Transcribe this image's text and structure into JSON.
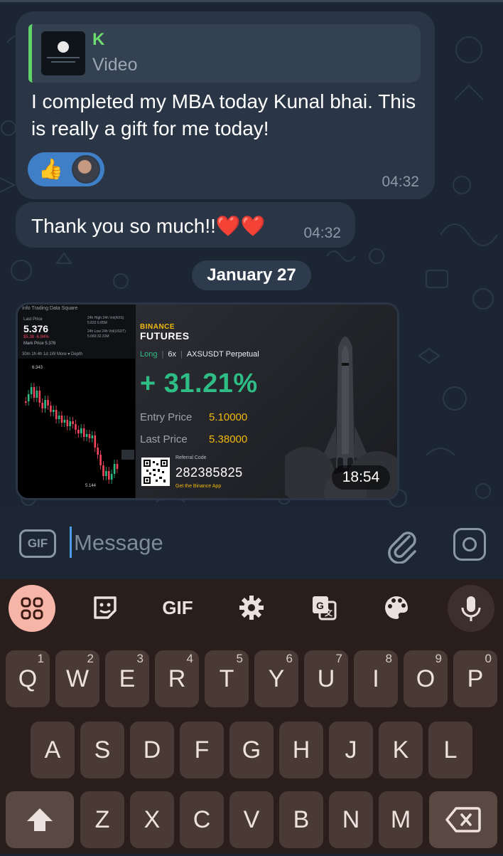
{
  "chat": {
    "message1": {
      "reply_name": "K",
      "reply_type": "Video",
      "text": "I completed my MBA today Kunal bhai. This is really a gift for me today!",
      "reaction_emoji": "👍",
      "time": "04:32"
    },
    "message2": {
      "text": "Thank you so much!!❤️❤️",
      "time": "04:32"
    },
    "date_separator": "January 27",
    "media": {
      "duration": "18:54",
      "app": {
        "tabs": "Info   Trading Data   Square",
        "last_price_label": "Last Price",
        "price": "5.376",
        "change": "$5.38  -6.94%",
        "mark_price": "Mark Price  5.376",
        "high_label": "24h High   24h Vol(AXS)",
        "high_values": "5.832    6.85M",
        "low_label": "24h Low   24h Vol(USDT)",
        "low_values": "5.060    32.31M",
        "intervals": "30m   1h   4h   1d   1W   More ▾   Depth",
        "chart_high_label": "6.343",
        "chart_low_label": "5.144"
      },
      "card": {
        "brand": "BINANCE",
        "product": "FUTURES",
        "side": "Long",
        "leverage": "6x",
        "symbol": "AXSUSDT Perpetual",
        "pnl": "+ 31.21%",
        "entry_label": "Entry Price",
        "entry_value": "5.10000",
        "last_label": "Last Price",
        "last_value": "5.38000",
        "referral_label": "Referral Code",
        "referral_code": "282385825",
        "app_cta": "Get the Binance App"
      }
    }
  },
  "composer": {
    "gif_label": "GIF",
    "placeholder": "Message",
    "attach_icon": "paperclip-icon",
    "camera_icon": "camera-icon"
  },
  "keyboard": {
    "toolbar": [
      {
        "name": "apps-grid-icon"
      },
      {
        "name": "sticker-icon"
      },
      {
        "name": "gif-button",
        "label": "GIF"
      },
      {
        "name": "settings-gear-icon"
      },
      {
        "name": "translate-icon"
      },
      {
        "name": "theme-palette-icon"
      },
      {
        "name": "microphone-icon"
      }
    ],
    "row1": [
      {
        "k": "Q",
        "n": "1"
      },
      {
        "k": "W",
        "n": "2"
      },
      {
        "k": "E",
        "n": "3"
      },
      {
        "k": "R",
        "n": "4"
      },
      {
        "k": "T",
        "n": "5"
      },
      {
        "k": "Y",
        "n": "6"
      },
      {
        "k": "U",
        "n": "7"
      },
      {
        "k": "I",
        "n": "8"
      },
      {
        "k": "O",
        "n": "9"
      },
      {
        "k": "P",
        "n": "0"
      }
    ],
    "row2": [
      "A",
      "S",
      "D",
      "F",
      "G",
      "H",
      "J",
      "K",
      "L"
    ],
    "row3": [
      "Z",
      "X",
      "C",
      "V",
      "B",
      "N",
      "M"
    ],
    "colors": {
      "key": "#4a3a35",
      "function_key": "#5a4843",
      "background": "#291e1b",
      "accent": "#f7b5a7"
    }
  }
}
